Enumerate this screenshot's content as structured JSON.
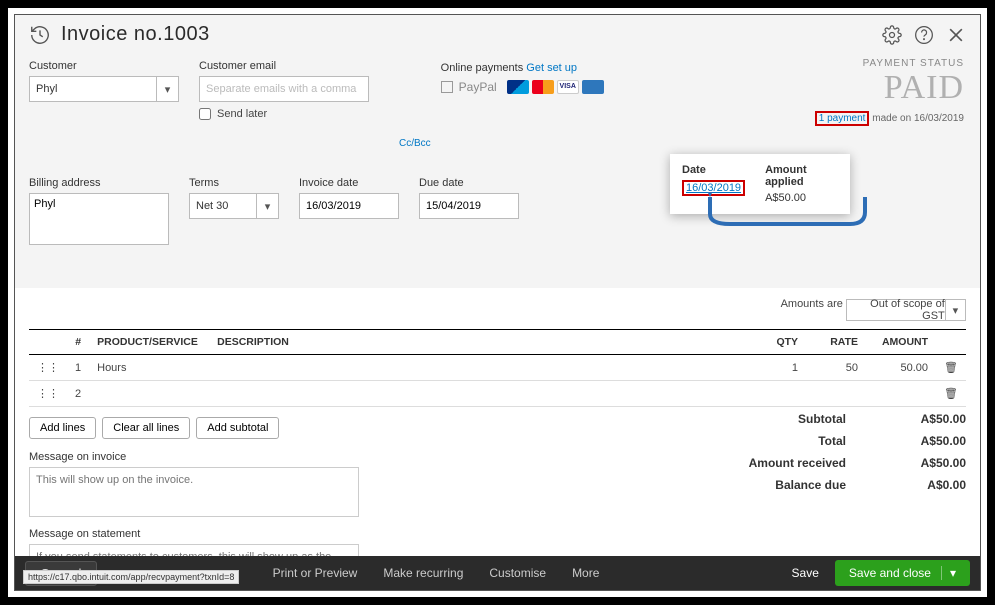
{
  "header": {
    "title": "Invoice no.1003"
  },
  "customer": {
    "label": "Customer",
    "value": "Phyl"
  },
  "email": {
    "label": "Customer email",
    "placeholder": "Separate emails with a comma",
    "send_later": "Send later",
    "ccbcc": "Cc/Bcc"
  },
  "online": {
    "label": "Online payments",
    "link": "Get set up",
    "paypal": "PayPal"
  },
  "payment_status": {
    "label": "PAYMENT STATUS",
    "value": "PAID",
    "link": "1 payment",
    "tail": "made on 16/03/2019"
  },
  "popover": {
    "date_label": "Date",
    "date_value": "16/03/2019",
    "amount_label": "Amount applied",
    "amount_value": "A$50.00"
  },
  "billing": {
    "label": "Billing address",
    "value": "Phyl"
  },
  "terms": {
    "label": "Terms",
    "value": "Net 30"
  },
  "invoice_date": {
    "label": "Invoice date",
    "value": "16/03/2019"
  },
  "due_date": {
    "label": "Due date",
    "value": "15/04/2019"
  },
  "amounts_are": {
    "label": "Amounts are",
    "value": "Out of scope of GST"
  },
  "cols": {
    "num": "#",
    "product": "PRODUCT/SERVICE",
    "desc": "DESCRIPTION",
    "qty": "QTY",
    "rate": "RATE",
    "amount": "AMOUNT"
  },
  "rows": [
    {
      "n": "1",
      "product": "Hours",
      "desc": "",
      "qty": "1",
      "rate": "50",
      "amount": "50.00"
    },
    {
      "n": "2",
      "product": "",
      "desc": "",
      "qty": "",
      "rate": "",
      "amount": ""
    }
  ],
  "linebtns": {
    "add": "Add lines",
    "clear": "Clear all lines",
    "subtotal": "Add subtotal"
  },
  "totals": {
    "subtotal_l": "Subtotal",
    "subtotal_v": "A$50.00",
    "total_l": "Total",
    "total_v": "A$50.00",
    "recv_l": "Amount received",
    "recv_v": "A$50.00",
    "bal_l": "Balance due",
    "bal_v": "A$0.00"
  },
  "msg_invoice": {
    "label": "Message on invoice",
    "placeholder": "This will show up on the invoice."
  },
  "msg_statement": {
    "label": "Message on statement",
    "placeholder": "If you send statements to customers, this will show up as the description for this invoice."
  },
  "footer": {
    "cancel": "Cancel",
    "print": "Print or Preview",
    "recurring": "Make recurring",
    "customise": "Customise",
    "more": "More",
    "save": "Save",
    "saveclose": "Save and close"
  },
  "statusbar": "https://c17.qbo.intuit.com/app/recvpayment?txnId=8"
}
